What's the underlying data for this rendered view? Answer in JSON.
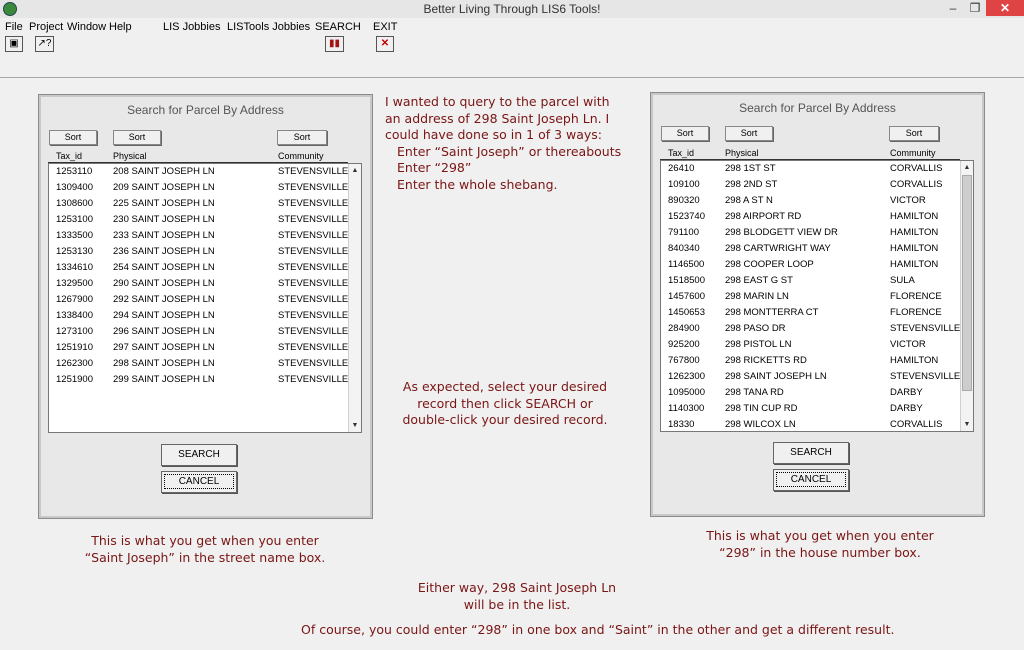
{
  "window": {
    "title": "Better Living Through LIS6 Tools!",
    "min_glyph": "–",
    "max_glyph": "❐",
    "close_glyph": "✕"
  },
  "menu": [
    "File",
    "Project",
    "Window",
    "Help",
    "LIS Jobbies",
    "LISTools Jobbies",
    "SEARCH",
    "EXIT"
  ],
  "toolbar": {
    "save_glyph": "▣",
    "help_glyph": "↗?",
    "search_glyph": "▮▮",
    "exit_glyph": "✕"
  },
  "left_dialog": {
    "title": "Search for Parcel By Address",
    "sort_labels": [
      "Sort",
      "Sort",
      "Sort"
    ],
    "columns": [
      "Tax_id",
      "Physical",
      "Community"
    ],
    "rows": [
      [
        "1253110",
        "208 SAINT JOSEPH LN",
        "STEVENSVILLE"
      ],
      [
        "1309400",
        "209 SAINT JOSEPH LN",
        "STEVENSVILLE"
      ],
      [
        "1308600",
        "225 SAINT JOSEPH LN",
        "STEVENSVILLE"
      ],
      [
        "1253100",
        "230 SAINT JOSEPH LN",
        "STEVENSVILLE"
      ],
      [
        "1333500",
        "233 SAINT JOSEPH LN",
        "STEVENSVILLE"
      ],
      [
        "1253130",
        "236 SAINT JOSEPH LN",
        "STEVENSVILLE"
      ],
      [
        "1334610",
        "254 SAINT JOSEPH LN",
        "STEVENSVILLE"
      ],
      [
        "1329500",
        "290 SAINT JOSEPH LN",
        "STEVENSVILLE"
      ],
      [
        "1267900",
        "292 SAINT JOSEPH LN",
        "STEVENSVILLE"
      ],
      [
        "1338400",
        "294 SAINT JOSEPH LN",
        "STEVENSVILLE"
      ],
      [
        "1273100",
        "296 SAINT JOSEPH LN",
        "STEVENSVILLE"
      ],
      [
        "1251910",
        "297 SAINT JOSEPH LN",
        "STEVENSVILLE"
      ],
      [
        "1262300",
        "298 SAINT JOSEPH LN",
        "STEVENSVILLE"
      ],
      [
        "1251900",
        "299 SAINT JOSEPH LN",
        "STEVENSVILLE"
      ]
    ],
    "search_label": "SEARCH",
    "cancel_label": "CANCEL"
  },
  "right_dialog": {
    "title": "Search for Parcel By Address",
    "sort_labels": [
      "Sort",
      "Sort",
      "Sort"
    ],
    "columns": [
      "Tax_id",
      "Physical",
      "Community"
    ],
    "rows": [
      [
        "26410",
        "298 1ST ST",
        "CORVALLIS"
      ],
      [
        "109100",
        "298 2ND ST",
        "CORVALLIS"
      ],
      [
        "890320",
        "298 A ST N",
        "VICTOR"
      ],
      [
        "1523740",
        "298 AIRPORT RD",
        "HAMILTON"
      ],
      [
        "791100",
        "298 BLODGETT VIEW DR",
        "HAMILTON"
      ],
      [
        "840340",
        "298 CARTWRIGHT WAY",
        "HAMILTON"
      ],
      [
        "1146500",
        "298 COOPER LOOP",
        "HAMILTON"
      ],
      [
        "1518500",
        "298 EAST G ST",
        "SULA"
      ],
      [
        "1457600",
        "298 MARIN LN",
        "FLORENCE"
      ],
      [
        "1450653",
        "298 MONTTERRA CT",
        "FLORENCE"
      ],
      [
        "284900",
        "298 PASO DR",
        "STEVENSVILLE"
      ],
      [
        "925200",
        "298 PISTOL LN",
        "VICTOR"
      ],
      [
        "767800",
        "298 RICKETTS RD",
        "HAMILTON"
      ],
      [
        "1262300",
        "298 SAINT JOSEPH LN",
        "STEVENSVILLE"
      ],
      [
        "1095000",
        "298 TANA RD",
        "DARBY"
      ],
      [
        "1140300",
        "298 TIN CUP RD",
        "DARBY"
      ],
      [
        "18330",
        "298 WILCOX LN",
        "CORVALLIS"
      ]
    ],
    "search_label": "SEARCH",
    "cancel_label": "CANCEL"
  },
  "notes": {
    "intro": [
      "I wanted to query to the parcel with",
      "an address of 298 Saint Joseph Ln.  I",
      "could have done so in 1 of 3 ways:"
    ],
    "ways": [
      "Enter “Saint Joseph” or thereabouts",
      "Enter “298”",
      "Enter the whole shebang."
    ],
    "expected": [
      "As expected, select your desired",
      "record then click SEARCH or",
      "double-click your desired record."
    ],
    "left_caption": [
      "This is what you get when you enter",
      "“Saint Joseph” in the street name box."
    ],
    "right_caption": [
      "This is what you get when you enter",
      "“298” in the house number box."
    ],
    "either_way": [
      "Either way, 298 Saint Joseph Ln",
      "will be in the list."
    ],
    "of_course": "Of course, you could enter “298” in one box and “Saint” in the other and get a different result."
  },
  "colors": {
    "note_text": "#7a1515",
    "close_button": "#e04343"
  }
}
